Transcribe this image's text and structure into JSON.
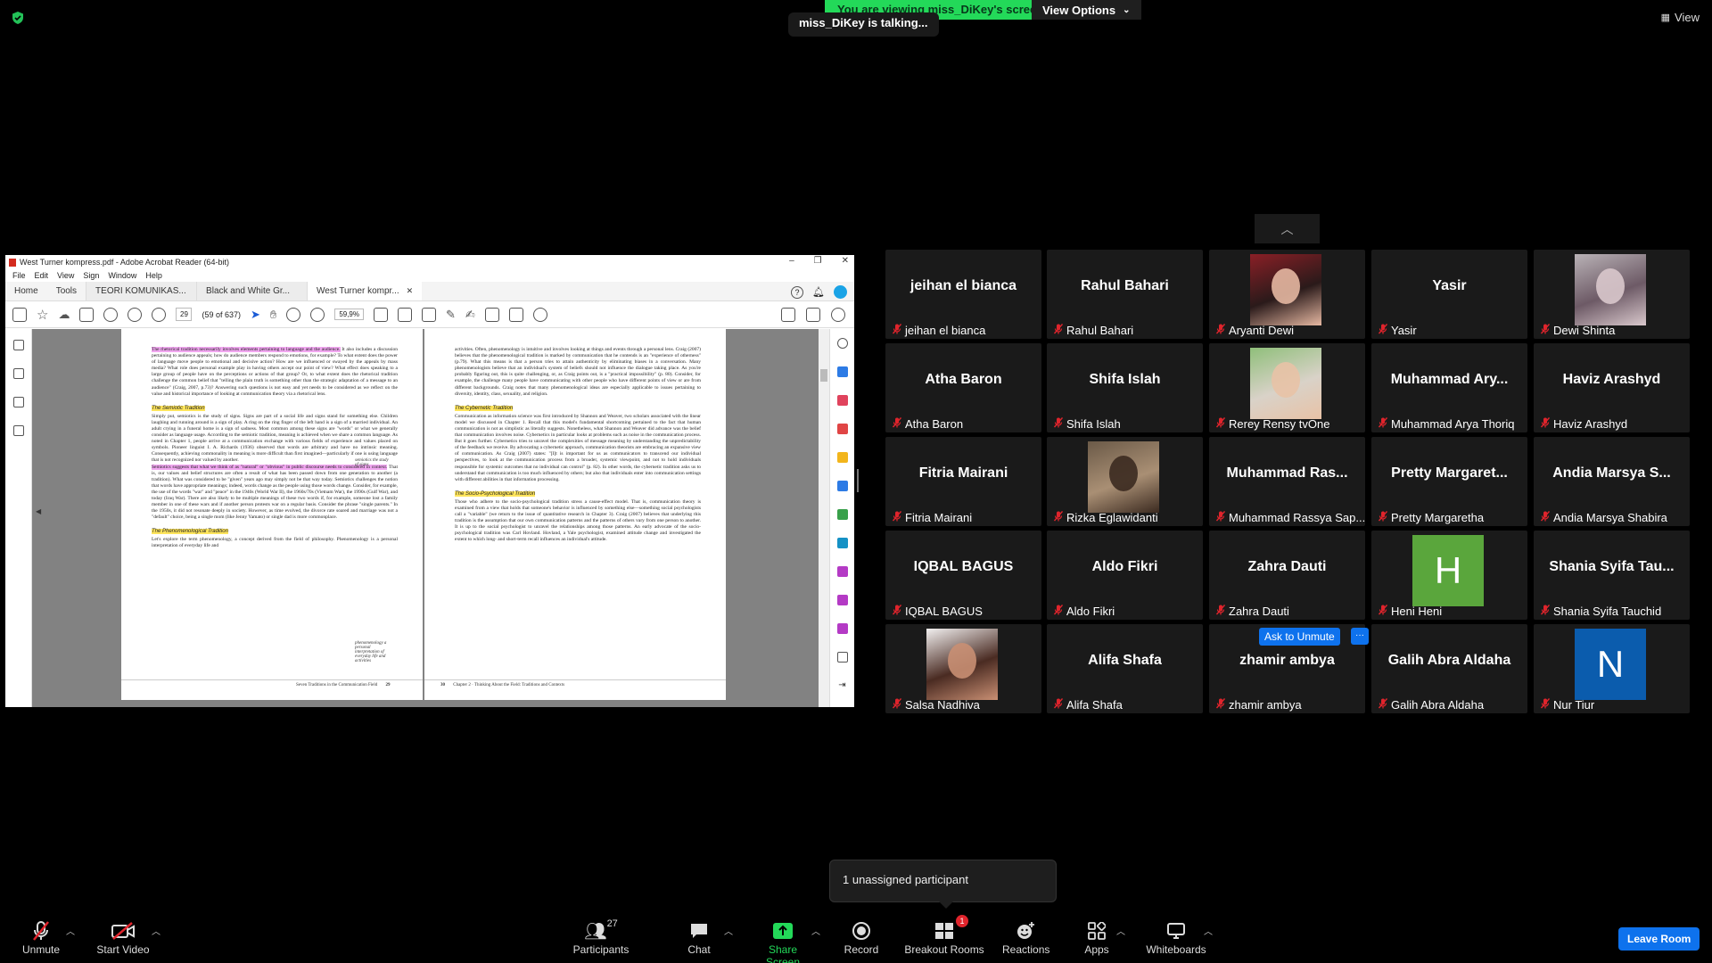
{
  "top": {
    "viewing_banner": "You are viewing miss_DiKey's screen",
    "view_options": "View Options",
    "talking": "miss_DiKey is talking...",
    "view_button": "View"
  },
  "acrobat": {
    "title": "West Turner kompress.pdf - Adobe Acrobat Reader (64-bit)",
    "menu": [
      "File",
      "Edit",
      "View",
      "Sign",
      "Window",
      "Help"
    ],
    "tabs": {
      "home": "Home",
      "tools": "Tools",
      "doc1": "TEORI KOMUNIKAS...",
      "doc2": "Black and White Gr...",
      "doc3": "West Turner kompr..."
    },
    "page_number": "29",
    "page_of": "(59 of 637)",
    "zoom": "59,9%",
    "left_page": {
      "para1_hl": "The rhetorical tradition necessarily involves elements pertaining to language and the audience.",
      "para1": "It also includes a discussion pertaining to audience appeals; how do audience members respond to emotions, for example? To what extent does the power of language move people to emotional and decisive action? How are we influenced or swayed by the appeals by mass media? What role does personal example play in having others accept our point of view? What effect does speaking to a large group of people have on the perceptions or actions of that group? Or, to what extent does the rhetorical tradition challenge the common belief that \"telling the plain truth is something other than the strategic adaptation of a message to an audience\" (Craig, 2007, p.73)? Answering such questions is not easy and yet needs to be considered as we reflect on the value and historical importance of looking at communication theory via a rhetorical lens.",
      "semiotic_heading": "The Semiotic Tradition",
      "para2": "Simply put, semiotics is the study of signs. Signs are part of a social life and signs stand for something else. Children laughing and running around is a sign of play. A ring on the ring finger of the left hand is a sign of a married individual. An adult crying in a funeral home is a sign of sadness. Most common among these signs are \"words\" or what we generally consider as language usage. According to the semiotic tradition, meaning is achieved when we share a common language. As noted in Chapter 1, people arrive at a communication exchange with various fields of experience and values placed on symbols. Pioneer linguist I. A. Richards (1936) observed that words are arbitrary and have no intrinsic meaning. Consequently, achieving commonality in meaning is more difficult than first imagined—particularly if one is using language that is not recognized nor valued by another.",
      "para3_hl": "Semiotics suggests that what we think of as \"natural\" or \"obvious\" in public discourse needs to considered in context.",
      "para3": "That is, our values and belief structures are often a result of what has been passed down from one generation to another (a tradition). What was considered to be \"given\" years ago may simply not be that way today. Semiotics challenges the notion that words have appropriate meanings; indeed, words change as the people using those words change. Consider, for example, the use of the words \"war\" and \"peace\" in the 1940s (World War II), the 1960s/70s (Vietnam War), the 1990s (Gulf War), and today (Iraq War). There are also likely to be multiple meanings of these two words if, for example, someone lost a family member in one of these wars and if another person protests war on a regular basis. Consider the phrase \"single parents.\" In the 1950s, it did not resonate deeply in society. However, as time evolved, the divorce rate soared and marriage was not a \"default\" choice, being a single mom (like Jenny Yamato) or single dad is more commonplace.",
      "phenom_heading": "The Phenomenological Tradition",
      "para4": "Let's explore the term phenomenology, a concept derived from the field of philosophy. Phenomenology is a personal interpretation of everyday life and",
      "note1": "semiotics the study of signs",
      "note2": "phenomenology a personal interpretation of everyday life and activities",
      "footer": "Seven Traditions in the Communication Field",
      "footer_page": "29"
    },
    "right_page": {
      "para1": "activities. Often, phenomenology is intuitive and involves looking at things and events through a personal lens. Craig (2007) believes that the phenomenological tradition is marked by communication that he contends is an \"experience of otherness\" (p.79). What this means is that a person tries to attain authenticity by eliminating biases in a conversation. Many phenomenologists believe that an individual's system of beliefs should not influence the dialogue taking place. As you're probably figuring out, this is quite challenging, or, as Craig points out, is a \"practical impossibility\" (p. 80). Consider, for example, the challenge many people have communicating with other people who have different points of view or are from different backgrounds. Craig notes that many phenomenological ideas are especially applicable to issues pertaining to diversity, identity, class, sexuality, and religion.",
      "cyber_heading": "The Cybernetic Tradition",
      "para2": "Communication as information science was first introduced by Shannon and Weaver, two scholars associated with the linear model we discussed in Chapter 1. Recall that this model's fundamental shortcoming pertained to the fact that human communication is not as simplistic as literally suggests. Nonetheless, what Shannon and Weaver did advance was the belief that communication involves noise. Cybernetics in particular looks at problems such as noise in the communication process. But it goes further. Cybernetics tries to unravel the complexities of message meaning by understanding the unpredictability of the feedback we receive. By advocating a cybernetic approach, communication theorists are embracing an expansive view of communication. As Craig (2007) states: \"[I]t is important for us as communicators to transcend our individual perspectives, to look at the communication process from a broader, systemic viewpoint, and not to hold individuals responsible for systemic outcomes that no individual can control\" (p. 82). In other words, the cybernetic tradition asks us to understand that communication is too much influenced by others; but also that individuals enter into communication settings with different abilities in that information processing.",
      "socio_heading": "The Socio-Psychological Tradition",
      "para3": "Those who adhere to the socio-psychological tradition stress a cause-effect model. That is, communication theory is examined from a view that holds that someone's behavior is influenced by something else—something social psychologists call a \"variable\" (we return to the issue of quantitative research in Chapter 3). Craig (2007) believes that underlying this tradition is the assumption that our own communication patterns and the patterns of others vary from one person to another. It is up to the social psychologist to unravel the relationships among those patterns. An early advocate of the socio-psychological tradition was Carl Hovland. Hovland, a Yale psychologist, examined attitude change and investigated the extent to which long- and short-term recall influences an individual's attitude.",
      "footer_page": "30",
      "footer": "Chapter 2 · Thinking About the Field: Traditions and Contexts"
    }
  },
  "participants": [
    {
      "big": "jeihan el bianca",
      "label": "jeihan el bianca"
    },
    {
      "big": "Rahul Bahari",
      "label": "Rahul Bahari"
    },
    {
      "photo": "aryanti",
      "label": "Aryanti Dewi"
    },
    {
      "big": "Yasir",
      "label": "Yasir"
    },
    {
      "photo": "dewi",
      "label": "Dewi Shinta"
    },
    {
      "big": "Atha Baron",
      "label": "Atha Baron"
    },
    {
      "big": "Shifa Islah",
      "label": "Shifa Islah"
    },
    {
      "photo": "rerey",
      "label": "Rerey Rensy tvOne"
    },
    {
      "big": "Muhammad Ary...",
      "label": "Muhammad Arya Thoriq"
    },
    {
      "big": "Haviz Arashyd",
      "label": "Haviz Arashyd"
    },
    {
      "big": "Fitria Mairani",
      "label": "Fitria Mairani"
    },
    {
      "photo": "rizka",
      "label": "Rizka Eglawidanti"
    },
    {
      "big": "Muhammad Ras...",
      "label": "Muhammad Rassya Sap..."
    },
    {
      "big": "Pretty Margaret...",
      "label": "Pretty Margaretha"
    },
    {
      "big": "Andia Marsya S...",
      "label": "Andia Marsya Shabira"
    },
    {
      "big": "IQBAL BAGUS",
      "label": "IQBAL BAGUS"
    },
    {
      "big": "Aldo Fikri",
      "label": "Aldo Fikri"
    },
    {
      "big": "Zahra Dauti",
      "label": "Zahra Dauti"
    },
    {
      "letter": "H",
      "letter_color": "#5aa63c",
      "label": "Heni Heni"
    },
    {
      "big": "Shania Syifa Tau...",
      "label": "Shania Syifa Tauchid"
    },
    {
      "photo": "salsa",
      "label": "Salsa Nadhiva"
    },
    {
      "big": "Alifa Shafa",
      "label": "Alifa Shafa"
    },
    {
      "big": "zhamir ambya",
      "label": "zhamir ambya",
      "ask_unmute": "Ask to Unmute",
      "more": "···"
    },
    {
      "big": "Galih Abra Aldaha",
      "label": "Galih Abra Aldaha"
    },
    {
      "letter": "N",
      "letter_color": "#0b5cad",
      "label": "Nur Tiur"
    }
  ],
  "unassigned": "1 unassigned participant",
  "toolbar": {
    "unmute": "Unmute",
    "start_video": "Start Video",
    "participants": "Participants",
    "participants_count": "27",
    "chat": "Chat",
    "share_screen": "Share Screen",
    "record": "Record",
    "breakout_rooms": "Breakout Rooms",
    "breakout_badge": "1",
    "reactions": "Reactions",
    "apps": "Apps",
    "whiteboards": "Whiteboards",
    "leave_room": "Leave Room"
  },
  "colors": {
    "accent_blue": "#0e72ed",
    "green": "#23d959",
    "mic_off": "#e0242c",
    "highlight_pink": "#f1a7f0",
    "highlight_yellow": "#ffe55c"
  }
}
